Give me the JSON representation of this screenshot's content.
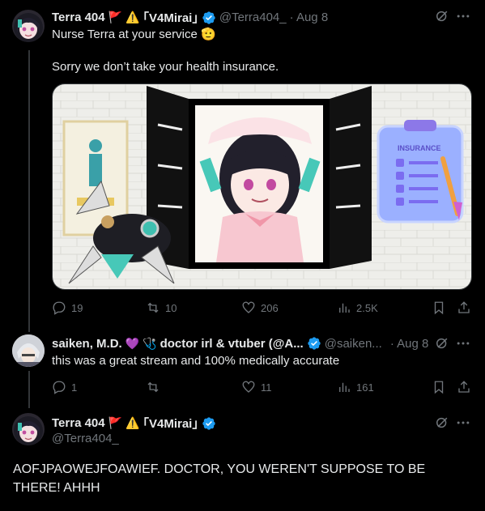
{
  "tweet1": {
    "name": "Terra 404",
    "flag_emoji": "🚩",
    "warning_emoji": "⚠️",
    "tag": "｢V4Mirai｣",
    "handle": "@Terra404_",
    "date": "· Aug 8",
    "line1": "Nurse Terra at your service",
    "emoji_salute": "🫡",
    "line2": "Sorry we don’t take your health insurance.",
    "media_insurance_label": "INSURANCE",
    "replies": "19",
    "reposts": "10",
    "likes": "206",
    "views": "2.5K"
  },
  "tweet2": {
    "name": "saiken, M.D.",
    "heart": "💜",
    "steth": "🩺",
    "name_rest": "doctor irl & vtuber (@A...",
    "handle": "@saiken...",
    "date": "· Aug 8",
    "text": "this was a great stream and 100% medically accurate",
    "replies": "1",
    "reposts": "",
    "likes": "11",
    "views": "161"
  },
  "tweet3": {
    "name": "Terra 404",
    "flag_emoji": "🚩",
    "warning_emoji": "⚠️",
    "tag": "｢V4Mirai｣",
    "handle": "@Terra404_",
    "text": "AOFJPAOWEJFOAWIEF. DOCTOR, YOU WEREN'T SUPPOSE TO BE THERE! AHHH"
  },
  "colors": {
    "background": "#000000",
    "text": "#e7e9ea",
    "muted": "#71767b",
    "verified": "#1d9bf0"
  }
}
